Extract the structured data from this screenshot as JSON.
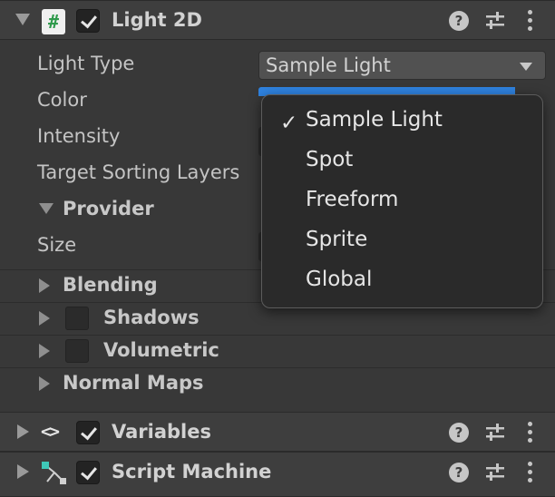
{
  "light2d": {
    "title": "Light 2D",
    "script_icon_glyph": "#",
    "enabled": true,
    "icons": {
      "help": "help-icon",
      "presets": "presets-sliders-icon",
      "menu": "kebab-menu-icon"
    }
  },
  "props": {
    "light_type_label": "Light Type",
    "light_type_value": "Sample Light",
    "color_label": "Color",
    "intensity_label": "Intensity",
    "target_sorting_label": "Target Sorting Layers"
  },
  "provider": {
    "title": "Provider",
    "size_label": "Size"
  },
  "sections": {
    "blending": "Blending",
    "shadows": "Shadows",
    "volumetric": "Volumetric",
    "normal_maps": "Normal Maps"
  },
  "dropdown_menu": {
    "selected": "Sample Light",
    "check_glyph": "✓",
    "options": [
      "Sample Light",
      "Spot",
      "Freeform",
      "Sprite",
      "Global"
    ]
  },
  "variables": {
    "title": "Variables",
    "icon_glyph": "<>",
    "enabled": true
  },
  "script_machine": {
    "title": "Script Machine",
    "enabled": true
  },
  "help_glyph": "?",
  "colors": {
    "accent": "#2f83e0",
    "panel": "#383838",
    "header": "#3e3e3e",
    "popup": "#2a2a2a"
  }
}
